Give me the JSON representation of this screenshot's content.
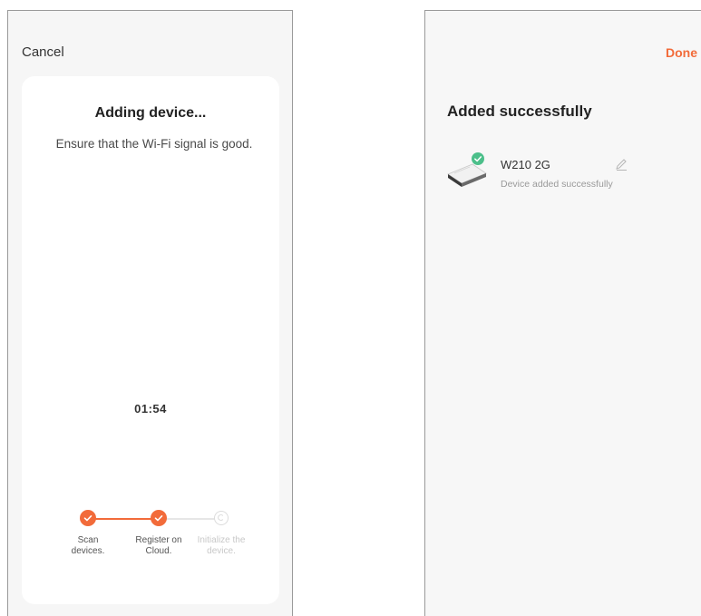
{
  "left_screen": {
    "cancel_label": "Cancel",
    "title": "Adding device...",
    "subtitle": "Ensure that the Wi-Fi signal is good.",
    "timer": "01:54",
    "steps": [
      {
        "label": "Scan devices.",
        "state": "done",
        "icon": "check-icon"
      },
      {
        "label": "Register on Cloud.",
        "state": "done",
        "icon": "check-icon"
      },
      {
        "label": "Initialize the device.",
        "state": "pending",
        "icon": "pending-circle-icon"
      }
    ]
  },
  "right_screen": {
    "done_label": "Done",
    "title": "Added successfully",
    "device": {
      "name": "W210 2G",
      "status": "Device added successfully",
      "image_icon": "device-image",
      "badge_icon": "success-check-badge-icon",
      "edit_icon": "edit-pencil-icon"
    }
  },
  "colors": {
    "accent": "#f26b3a",
    "success": "#4cbf8a",
    "pending": "#dcdcdc",
    "card_bg": "#ffffff",
    "screen_bg": "#f6f6f6"
  }
}
